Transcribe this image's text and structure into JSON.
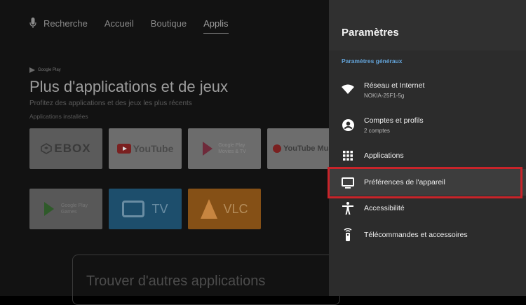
{
  "topnav": {
    "search": "Recherche",
    "home": "Accueil",
    "shop": "Boutique",
    "apps": "Applis"
  },
  "hero": {
    "badge": "Google Play",
    "title": "Plus d'applications et de jeux",
    "subtitle": "Profitez des applications et des jeux les plus récents",
    "installed_label": "Applications installées"
  },
  "apps": {
    "ebox": "EBOX",
    "youtube": "YouTube",
    "gp_movies_1": "Google Play",
    "gp_movies_2": "Movies & TV",
    "youtube_music": "YouTube Music",
    "gp_games_1": "Google Play",
    "gp_games_2": "Games",
    "tv": "TV",
    "vlc": "VLC"
  },
  "find_more": "Trouver d'autres applications",
  "settings": {
    "title": "Paramètres",
    "section": "Paramètres généraux",
    "items": [
      {
        "label": "Réseau et Internet",
        "sub": "NOKIA-25F1-5g",
        "icon": "wifi-icon"
      },
      {
        "label": "Comptes et profils",
        "sub": "2 comptes",
        "icon": "account-icon"
      },
      {
        "label": "Applications",
        "icon": "apps-grid-icon"
      },
      {
        "label": "Préférences de l'appareil",
        "icon": "tv-icon"
      },
      {
        "label": "Accessibilité",
        "icon": "accessibility-icon"
      },
      {
        "label": "Télécommandes et accessoires",
        "icon": "remote-icon"
      }
    ],
    "selected_index": 3,
    "highlight_color": "#c8242a",
    "section_color": "#63a3d8"
  }
}
